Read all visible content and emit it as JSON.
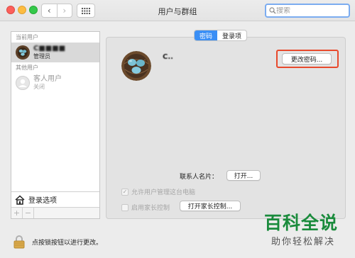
{
  "window": {
    "title": "用户与群组"
  },
  "toolbar": {
    "back": "‹",
    "forward": "›",
    "search_placeholder": "搜索"
  },
  "sidebar": {
    "current_users_label": "当前用户",
    "current_user": {
      "name": "C■■■■",
      "role": "管理员"
    },
    "other_users_label": "其他用户",
    "guest_user": {
      "name": "客人用户",
      "role": "关闭"
    },
    "login_options": "登录选项",
    "add": "+",
    "remove": "−"
  },
  "tabs": [
    {
      "label": "密码",
      "active": true
    },
    {
      "label": "登录项",
      "active": false
    }
  ],
  "main": {
    "account_name": "C..",
    "change_password": "更改密码...",
    "contact_card_label": "联系人名片：",
    "open_button": "打开...",
    "allow_admin": "允许用户管理这台电脑",
    "allow_admin_checked": true,
    "enable_parental": "启用家长控制",
    "enable_parental_checked": false,
    "open_parental": "打开家长控制..."
  },
  "lock": {
    "text": "点按锁按钮以进行更改。"
  },
  "watermark": {
    "title": "百科全说",
    "subtitle": "助你轻松解决"
  },
  "colors": {
    "tab_active": "#3b8ff5",
    "highlight_box": "#e8492c",
    "watermark": "#1a8b3c"
  }
}
